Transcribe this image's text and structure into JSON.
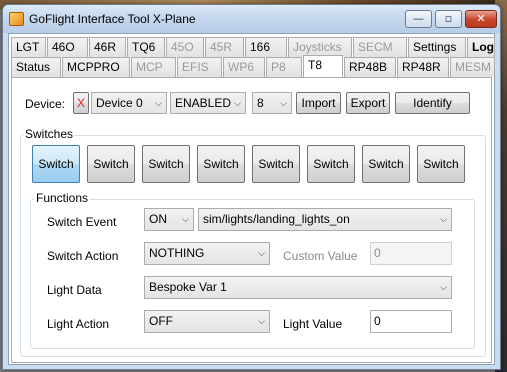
{
  "window": {
    "title": "GoFlight Interface Tool X-Plane",
    "controls": {
      "minimize": "—",
      "maximize": "▫",
      "close": "✕"
    }
  },
  "tabs_row1": [
    {
      "label": "LGT",
      "disabled": false
    },
    {
      "label": "46O",
      "disabled": false
    },
    {
      "label": "46R",
      "disabled": false
    },
    {
      "label": "TQ6",
      "disabled": false
    },
    {
      "label": "45O",
      "disabled": true
    },
    {
      "label": "45R",
      "disabled": true
    },
    {
      "label": "166",
      "disabled": false
    },
    {
      "label": "Joysticks",
      "disabled": true
    },
    {
      "label": "SECM",
      "disabled": true
    },
    {
      "label": "Settings",
      "disabled": false
    },
    {
      "label": "Log",
      "disabled": false
    }
  ],
  "tabs_row2": [
    {
      "label": "Status",
      "disabled": false
    },
    {
      "label": "MCPPRO",
      "disabled": false
    },
    {
      "label": "MCP",
      "disabled": true
    },
    {
      "label": "EFIS",
      "disabled": true
    },
    {
      "label": "WP6",
      "disabled": true
    },
    {
      "label": "P8",
      "disabled": true
    },
    {
      "label": "T8",
      "disabled": false
    },
    {
      "label": "RP48B",
      "disabled": false
    },
    {
      "label": "RP48R",
      "disabled": false
    },
    {
      "label": "MESM",
      "disabled": true
    }
  ],
  "device_bar": {
    "device_label": "Device:",
    "remove_label": "X",
    "device_select": "Device 0",
    "state_select": "ENABLED",
    "number_select": "8",
    "import_label": "Import",
    "export_label": "Export",
    "identify_label": "Identify"
  },
  "switches": {
    "group_label": "Switches",
    "buttons": [
      "Switch",
      "Switch",
      "Switch",
      "Switch",
      "Switch",
      "Switch",
      "Switch",
      "Switch"
    ],
    "selected_index": 0
  },
  "functions": {
    "group_label": "Functions",
    "switch_event_label": "Switch Event",
    "switch_event_value": "ON",
    "dataref_value": "sim/lights/landing_lights_on",
    "switch_action_label": "Switch Action",
    "switch_action_value": "NOTHING",
    "custom_value_label": "Custom Value",
    "custom_value": "0",
    "light_data_label": "Light Data",
    "light_data_value": "Bespoke Var 1",
    "light_action_label": "Light Action",
    "light_action_value": "OFF",
    "light_value_label": "Light Value",
    "light_value": "0"
  }
}
